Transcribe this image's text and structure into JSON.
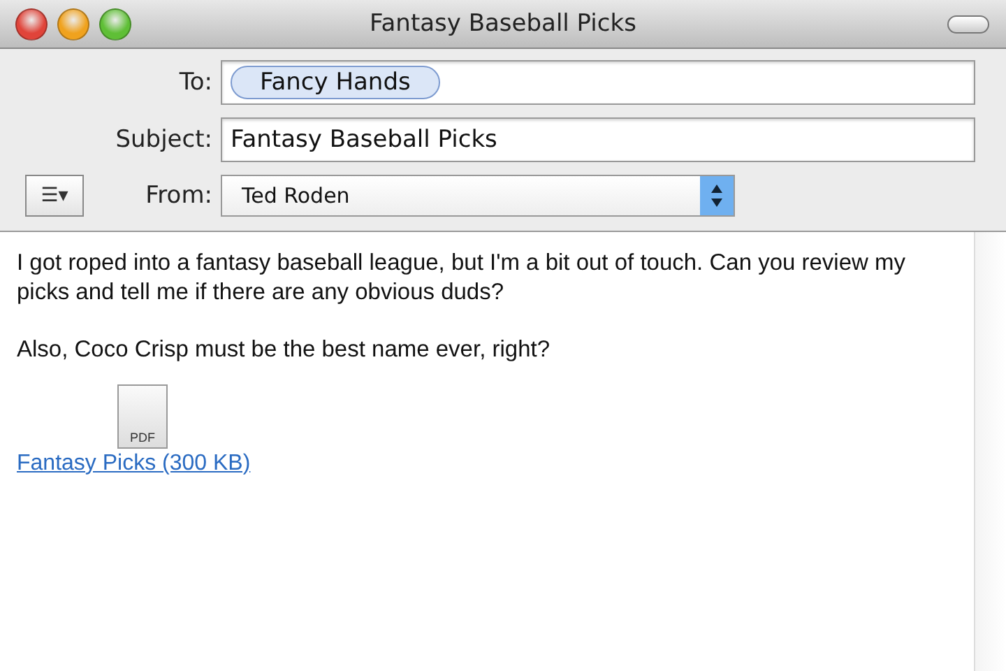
{
  "window": {
    "title": "Fantasy Baseball Picks"
  },
  "header": {
    "to_label": "To:",
    "recipients": [
      "Fancy Hands"
    ],
    "subject_label": "Subject:",
    "subject": "Fantasy Baseball Picks",
    "from_label": "From:",
    "from": "Ted Roden",
    "menu_glyph": "☰▾"
  },
  "body": {
    "paragraphs": [
      "I got roped into a fantasy baseball league, but I'm a bit out of touch. Can you review my picks and tell me if there are any obvious duds?",
      "Also, Coco Crisp must be the best name ever, right?"
    ]
  },
  "attachment": {
    "icon_label": "PDF",
    "name": "Fantasy Picks (300 KB)"
  }
}
